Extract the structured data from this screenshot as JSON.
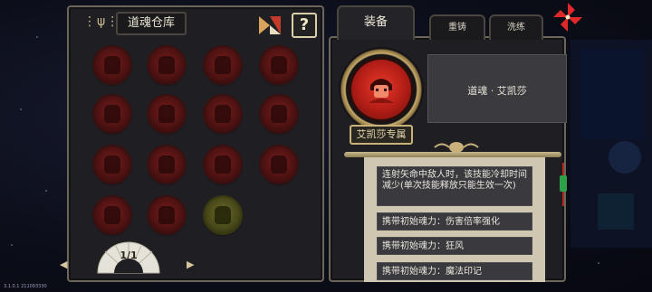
{
  "left_panel": {
    "title": "道魂仓库",
    "help_label": "?",
    "page_indicator": "1/1",
    "prev_label": "◀",
    "next_label": "▶",
    "souls": [
      {
        "type": "red"
      },
      {
        "type": "red"
      },
      {
        "type": "red"
      },
      {
        "type": "red"
      },
      {
        "type": "red"
      },
      {
        "type": "red"
      },
      {
        "type": "red"
      },
      {
        "type": "red"
      },
      {
        "type": "red"
      },
      {
        "type": "red"
      },
      {
        "type": "red"
      },
      {
        "type": "red"
      },
      {
        "type": "red"
      },
      {
        "type": "red"
      },
      {
        "type": "gold"
      }
    ]
  },
  "right_panel": {
    "tabs": {
      "equip": "装备",
      "reforge": "重铸",
      "wash": "洗练"
    },
    "soul_name": "道魂 · 艾凯莎",
    "exclusive_badge": "艾凯莎专属",
    "effect_main": "连射矢命中敌人时，该技能冷却时间减少(单次技能释放只能生效一次)",
    "effects": [
      "携带初始魂力：伤害倍率强化",
      "携带初始魂力：狂风",
      "携带初始魂力：魔法印记"
    ]
  },
  "version": "3.1.0.1 211093330",
  "colors": {
    "panel_bg": "#1f1e22",
    "panel_border": "#6b655a",
    "orb_red": "#7a1c1c",
    "portrait_red": "#e53a2a",
    "gold_trim": "#c9b27a"
  },
  "icons": {
    "sort": "sort-icon",
    "help": "question-icon",
    "windmill": "windmill-icon"
  }
}
